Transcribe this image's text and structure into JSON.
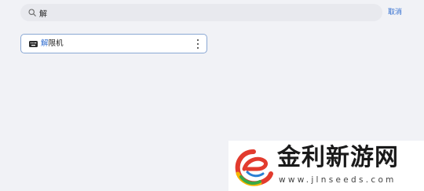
{
  "search": {
    "query": "解",
    "icon": "search-icon",
    "cancel_label": "取消"
  },
  "results": [
    {
      "icon": "keyboard-icon",
      "label_highlight": "解",
      "label_rest": "限机",
      "menu_icon": "more-vertical-icon"
    }
  ],
  "watermark": {
    "title": "金利新游网",
    "url": "www.jlnseeds.com"
  },
  "colors": {
    "background": "#f1f2f6",
    "accent": "#2f6ccf",
    "search_bg": "#e8e9ee",
    "item_border": "#8aa8d4"
  }
}
